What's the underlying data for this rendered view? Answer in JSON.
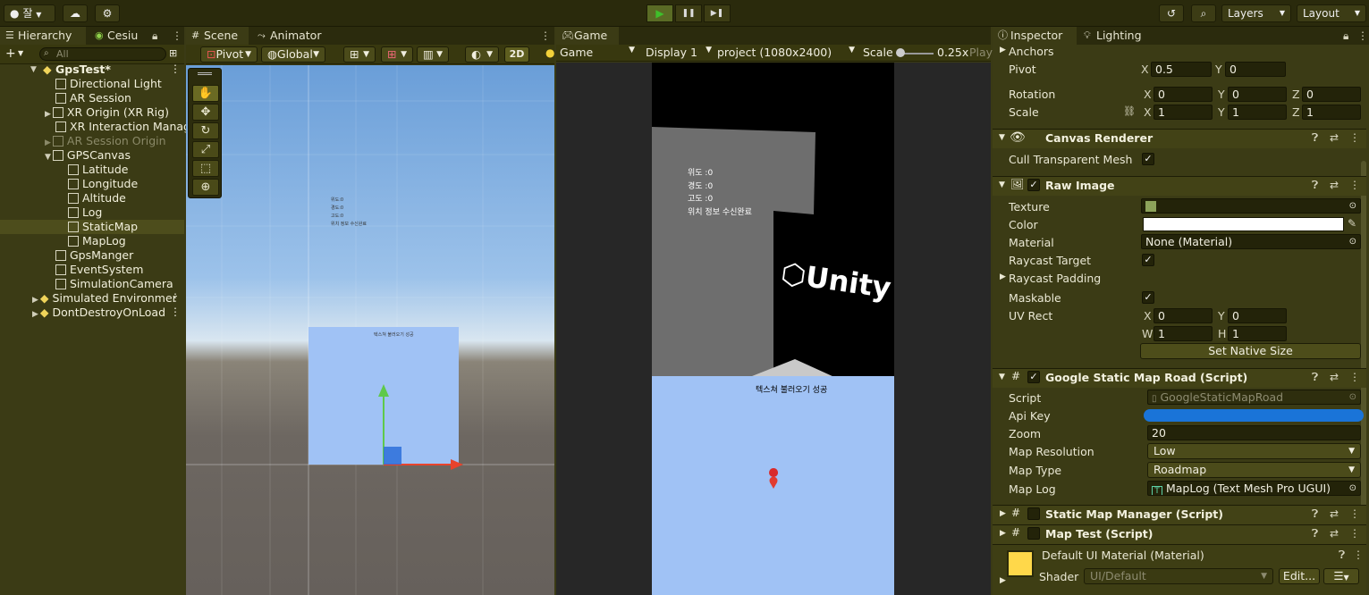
{
  "toolbar": {
    "account_label": "잘",
    "cloud_icon": "cloud-icon",
    "play_icon": "▶",
    "pause_icon": "❚❚",
    "step_icon": "▶❚",
    "layers_label": "Layers",
    "layout_label": "Layout"
  },
  "hierarchy": {
    "tab_label": "Hierarchy",
    "tab2_label": "Cesiu",
    "search_placeholder": "All",
    "items": [
      {
        "label": "GpsTest*"
      },
      {
        "label": "Directional Light"
      },
      {
        "label": "AR Session"
      },
      {
        "label": "XR Origin (XR Rig)"
      },
      {
        "label": "XR Interaction Manage"
      },
      {
        "label": "AR Session Origin"
      },
      {
        "label": "GPSCanvas"
      },
      {
        "label": "Latitude"
      },
      {
        "label": "Longitude"
      },
      {
        "label": "Altitude"
      },
      {
        "label": "Log"
      },
      {
        "label": "StaticMap"
      },
      {
        "label": "MapLog"
      },
      {
        "label": "GpsManger"
      },
      {
        "label": "EventSystem"
      },
      {
        "label": "SimulationCamera"
      },
      {
        "label": "Simulated Environmer"
      },
      {
        "label": "DontDestroyOnLoad"
      }
    ]
  },
  "scene": {
    "tab_label": "Scene",
    "tab2_label": "Animator",
    "pivot_label": "Pivot",
    "global_label": "Global",
    "mode_2d_label": "2D",
    "canvas_lines": [
      "위도:0",
      "경도:0",
      "고도:0",
      "위치 정보 수신완료"
    ],
    "map_text": "텍스쳐 불러오기 성공"
  },
  "game": {
    "tab_label": "Game",
    "game_label": "Game",
    "display_label": "Display 1",
    "resolution_label": "project (1080x2400)",
    "scale_label": "Scale",
    "scale_value": "0.25x",
    "play_label": "Play",
    "lines": [
      "위도 :0",
      "경도 :0",
      "고도 :0",
      "위치 정보 수신완료"
    ],
    "unity_text": "Unity",
    "map_text": "텍스쳐 불러오기 성공"
  },
  "inspector": {
    "tab_label": "Inspector",
    "tab2_label": "Lighting",
    "anchors_label": "Anchors",
    "pivot_label": "Pivot",
    "pivot_x": "0.5",
    "pivot_y": "0",
    "rotation_label": "Rotation",
    "rotation": [
      "0",
      "0",
      "0"
    ],
    "scale_label": "Scale",
    "scale": [
      "1",
      "1",
      "1"
    ],
    "canvas_renderer": {
      "title": "Canvas Renderer",
      "cull_label": "Cull Transparent Mesh"
    },
    "raw_image": {
      "title": "Raw Image",
      "texture_label": "Texture",
      "color_label": "Color",
      "material_label": "Material",
      "material_value": "None (Material)",
      "raycast_target_label": "Raycast Target",
      "raycast_padding_label": "Raycast Padding",
      "maskable_label": "Maskable",
      "uv_rect_label": "UV Rect",
      "uv_x": "0",
      "uv_y": "0",
      "uv_w": "1",
      "uv_h": "1",
      "set_native_size_label": "Set Native Size"
    },
    "static_map_road": {
      "title": "Google Static Map Road (Script)",
      "script_label": "Script",
      "script_value": "GoogleStaticMapRoad",
      "api_key_label": "Api Key",
      "zoom_label": "Zoom",
      "zoom_value": "20",
      "map_resolution_label": "Map Resolution",
      "map_resolution_value": "Low",
      "map_type_label": "Map Type",
      "map_type_value": "Roadmap",
      "map_log_label": "Map Log",
      "map_log_value": "MapLog (Text Mesh Pro UGUI)"
    },
    "static_map_manager_title": "Static Map Manager (Script)",
    "map_test_title": "Map Test (Script)",
    "material": {
      "title": "Default UI Material (Material)",
      "shader_label": "Shader",
      "shader_value": "UI/Default",
      "edit_label": "Edit..."
    }
  },
  "colors": {
    "accent_blue": "#1a74d8",
    "play_green": "#3fbf2b",
    "map_blue": "#a0c2f5"
  }
}
